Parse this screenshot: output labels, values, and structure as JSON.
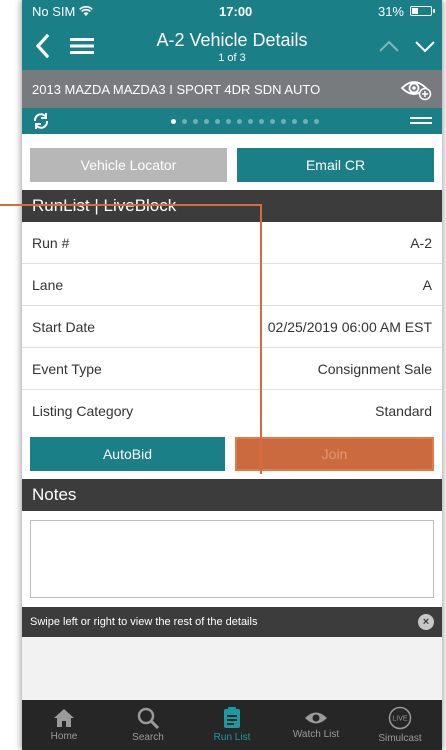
{
  "status_bar": {
    "carrier": "No SIM",
    "time": "17:00",
    "battery": "31%"
  },
  "navbar": {
    "title": "A-2 Vehicle Details",
    "subtitle": "1 of 3"
  },
  "vehicle": {
    "name": "2013 MAZDA MAZDA3 I SPORT 4DR SDN AUTO"
  },
  "pager": {
    "total_dots": 14,
    "active_index": 0
  },
  "top_buttons": {
    "vehicle_locator": "Vehicle Locator",
    "email_cr": "Email CR"
  },
  "runlist": {
    "header": "RunList | LiveBlock",
    "rows": [
      {
        "label": "Run #",
        "value": "A-2"
      },
      {
        "label": "Lane",
        "value": "A"
      },
      {
        "label": "Start Date",
        "value": "02/25/2019 06:00 AM EST"
      },
      {
        "label": "Event Type",
        "value": "Consignment Sale"
      },
      {
        "label": "Listing Category",
        "value": "Standard"
      }
    ]
  },
  "action_buttons": {
    "autobid": "AutoBid",
    "join": "Join"
  },
  "notes": {
    "header": "Notes"
  },
  "toast": {
    "message": "Swipe left or right to view the rest of the details"
  },
  "tabbar": {
    "tabs": [
      {
        "label": "Home",
        "icon": "home-icon"
      },
      {
        "label": "Search",
        "icon": "search-icon"
      },
      {
        "label": "Run List",
        "icon": "run-list-icon",
        "active": true
      },
      {
        "label": "Watch List",
        "icon": "eye-icon"
      },
      {
        "label": "Simulcast",
        "icon": "live-icon"
      }
    ]
  },
  "colors": {
    "accent": "#1a7f86",
    "dark": "#3c3c3c",
    "orange": "#cc6a3f",
    "gray_header": "#777b7d"
  }
}
